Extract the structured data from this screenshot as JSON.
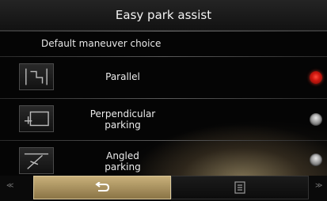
{
  "header": {
    "title": "Easy park assist"
  },
  "section": {
    "label": "Default maneuver choice"
  },
  "options": [
    {
      "icon": "parallel-parking-icon",
      "line1": "Parallel",
      "line2": "",
      "selected": true
    },
    {
      "icon": "perpendicular-parking-icon",
      "line1": "Perpendicular",
      "line2": "parking",
      "selected": false
    },
    {
      "icon": "angled-parking-icon",
      "line1": "Angled",
      "line2": "parking",
      "selected": false
    }
  ],
  "footer": {
    "back_icon": "back-arrow-icon",
    "menu_icon": "list-menu-icon"
  },
  "colors": {
    "accent_gold": "#c8b07a",
    "selected_radio": "#d01810"
  }
}
